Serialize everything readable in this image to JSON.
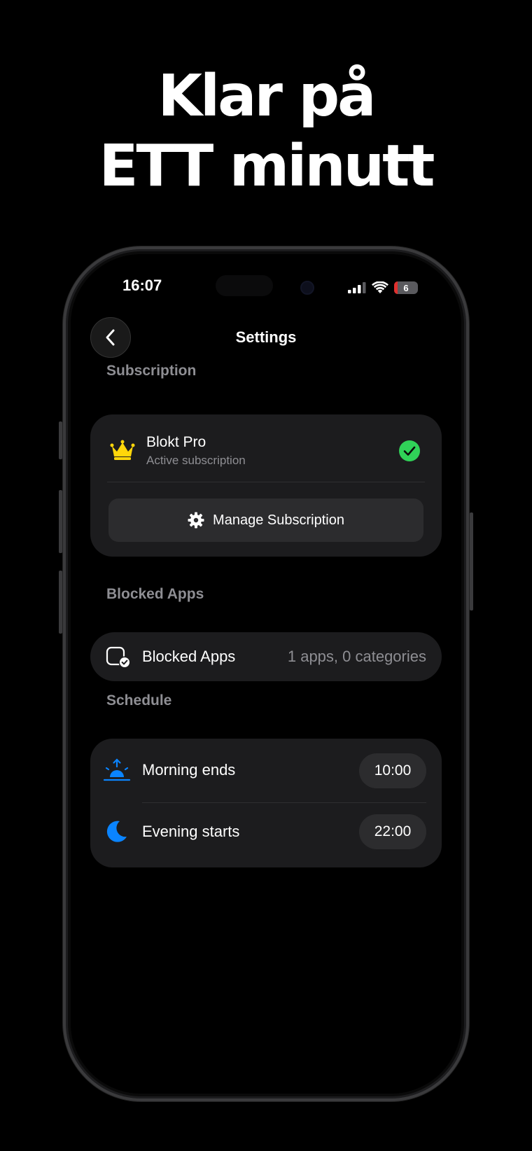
{
  "headline": {
    "line1": "Klar på",
    "line2": "ETT minutt"
  },
  "status_bar": {
    "time": "16:07",
    "battery": "6"
  },
  "nav": {
    "title": "Settings"
  },
  "subscription": {
    "section_label": "Subscription",
    "plan_name": "Blokt Pro",
    "plan_status": "Active subscription",
    "manage_label": "Manage Subscription"
  },
  "blocked_apps": {
    "section_label": "Blocked Apps",
    "row_label": "Blocked Apps",
    "row_value": "1 apps, 0 categories"
  },
  "schedule": {
    "section_label": "Schedule",
    "items": [
      {
        "label": "Morning ends",
        "time": "10:00",
        "icon": "sunrise-icon"
      },
      {
        "label": "Evening starts",
        "time": "22:00",
        "icon": "moon-icon"
      }
    ]
  },
  "colors": {
    "accent_blue": "#0a84ff",
    "crown_yellow": "#ffd60a",
    "check_green": "#30d158",
    "card_bg": "#1c1c1e"
  }
}
